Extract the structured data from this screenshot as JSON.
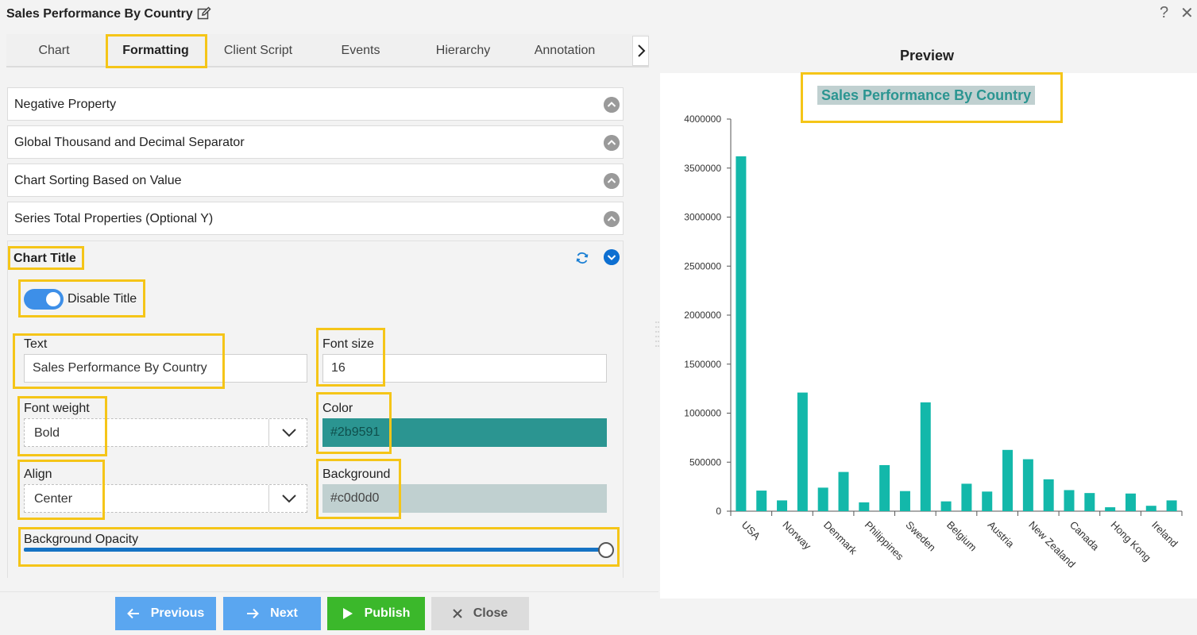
{
  "app": {
    "title": "Sales Performance By Country"
  },
  "tabs": [
    {
      "label": "Chart",
      "active": false
    },
    {
      "label": "Formatting",
      "active": true
    },
    {
      "label": "Client Script",
      "active": false
    },
    {
      "label": "Events",
      "active": false
    },
    {
      "label": "Hierarchy",
      "active": false
    },
    {
      "label": "Annotation",
      "active": false
    }
  ],
  "accordion": [
    {
      "label": "Negative Property"
    },
    {
      "label": "Global Thousand and Decimal Separator"
    },
    {
      "label": "Chart Sorting Based on Value"
    },
    {
      "label": "Series Total Properties (Optional Y)"
    }
  ],
  "chart_title_panel": {
    "heading": "Chart Title",
    "toggle_label": "Disable Title",
    "toggle_on": true,
    "text_label": "Text",
    "text_value": "Sales Performance By Country",
    "font_size_label": "Font size",
    "font_size_value": "16",
    "font_weight_label": "Font weight",
    "font_weight_value": "Bold",
    "color_label": "Color",
    "color_value": "#2b9591",
    "align_label": "Align",
    "align_value": "Center",
    "background_label": "Background",
    "background_value": "#c0d0d0",
    "opacity_label": "Background Opacity",
    "opacity_value": 1.0
  },
  "footer": {
    "previous": "Previous",
    "next": "Next",
    "publish": "Publish",
    "close": "Close"
  },
  "preview": {
    "heading": "Preview",
    "chart_title": "Sales Performance By Country",
    "title_color": "#2b9591",
    "title_background": "#c0d0d0"
  },
  "colors": {
    "bar": "#13b8aa",
    "highlight": "#f5c518",
    "primary_button": "#5aa6f0",
    "publish_button": "#3bb82b"
  },
  "chart_data": {
    "type": "bar",
    "title": "Sales Performance By Country",
    "xlabel": "",
    "ylabel": "",
    "ylim": [
      0,
      4000000
    ],
    "yticks": [
      0,
      500000,
      1000000,
      1500000,
      2000000,
      2500000,
      3000000,
      3500000,
      4000000
    ],
    "tick_labels": [
      "USA",
      "Norway",
      "Denmark",
      "Philippines",
      "Sweden",
      "Belgium",
      "Austria",
      "New Zealand",
      "Canada",
      "Hong Kong",
      "Ireland"
    ],
    "values": [
      3620000,
      210000,
      110000,
      1210000,
      240000,
      400000,
      90000,
      470000,
      205000,
      1110000,
      100000,
      280000,
      200000,
      625000,
      530000,
      325000,
      215000,
      185000,
      40000,
      180000,
      55000,
      110000
    ]
  }
}
